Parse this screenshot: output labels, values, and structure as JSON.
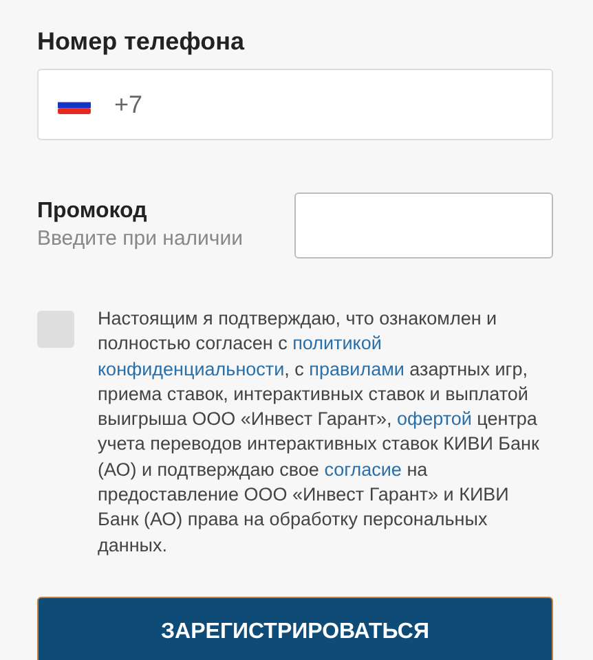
{
  "phone": {
    "label": "Номер телефона",
    "prefix": "+7"
  },
  "promo": {
    "label": "Промокод",
    "hint": "Введите при наличии"
  },
  "consent": {
    "checked": false,
    "segments": [
      {
        "text": "Настоящим я подтверждаю, что ознакомлен и полностью согласен с ",
        "link": false
      },
      {
        "text": "политикой ",
        "link": true
      },
      {
        "text": "конфиденциальности",
        "link": true
      },
      {
        "text": ", с ",
        "link": false
      },
      {
        "text": "правилами",
        "link": true
      },
      {
        "text": " азартных игр, приема ставок, интерактивных ставок и выплатой выигрыша ООО «Инвест Гарант», ",
        "link": false
      },
      {
        "text": "офертой",
        "link": true
      },
      {
        "text": " центра учета переводов интерактивных ставок КИВИ Банк (АО) и подтверждаю свое ",
        "link": false
      },
      {
        "text": "согласие",
        "link": true
      },
      {
        "text": " на предоставление ООО «Инвест Гарант» и КИВИ Банк (АО) права на обработку персональных данных.",
        "link": false
      }
    ]
  },
  "submit": "ЗАРЕГИСТРИРОВАТЬСЯ"
}
